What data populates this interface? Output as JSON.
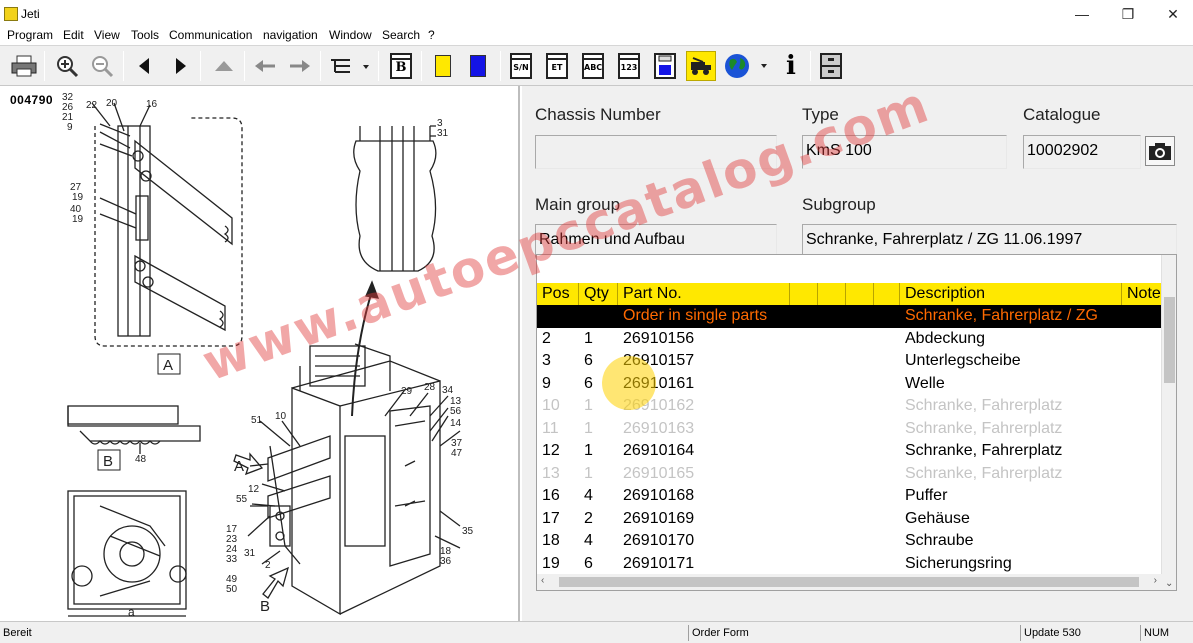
{
  "window": {
    "title": "Jeti"
  },
  "menu": [
    "Program",
    "Edit",
    "View",
    "Tools",
    "Communication",
    "navigation",
    "Window",
    "Search",
    "?"
  ],
  "toolbar": {
    "icons": [
      "printer-icon",
      "zoom-in-icon",
      "zoom-out-icon",
      "back-triangle-icon",
      "forward-triangle-icon",
      "up-triangle-icon",
      "arrow-left-icon",
      "arrow-right-icon",
      "tree-view-icon",
      "bookmark-b-icon",
      "yellow-square-icon",
      "blue-square-icon",
      "doc-sn-icon",
      "doc-et-icon",
      "doc-abc-icon",
      "doc-123-icon",
      "save-disk-icon",
      "truck-icon",
      "globe-icon",
      "info-icon",
      "cabinet-icon"
    ],
    "doc_labels": {
      "sn": "S/N",
      "et": "ET",
      "abc": "ABC",
      "num": "123"
    },
    "bookmark_letter": "B",
    "info_glyph": "i"
  },
  "drawing": {
    "id": "004790",
    "callouts": [
      "32",
      "26",
      "21",
      "9",
      "22",
      "20",
      "16",
      "27",
      "19",
      "40",
      "19",
      "3",
      "31",
      "29",
      "28",
      "34",
      "13",
      "56",
      "14",
      "37",
      "47",
      "51",
      "10",
      "12",
      "55",
      "17",
      "23",
      "24",
      "33",
      "49",
      "50",
      "31",
      "2",
      "48",
      "35",
      "18",
      "36"
    ],
    "view_labels": [
      "A",
      "B",
      "A",
      "B"
    ],
    "dim_label": "a"
  },
  "fields": {
    "chassis_label": "Chassis Number",
    "chassis_value": "",
    "type_label": "Type",
    "type_value": "KmS 100",
    "catalogue_label": "Catalogue",
    "catalogue_value": "10002902",
    "main_group_label": "Main group",
    "main_group_value": "Rahmen und Aufbau",
    "subgroup_label": "Subgroup",
    "subgroup_value": "Schranke, Fahrerplatz / ZG 11.06.1997"
  },
  "grid": {
    "columns": {
      "pos": "Pos",
      "qty": "Qty",
      "part": "Part No.",
      "desc": "Description",
      "note": "Note"
    },
    "rows": [
      {
        "pos": "",
        "qty": "",
        "part": "Order in single parts",
        "desc": "Schranke, Fahrerplatz / ZG",
        "state": "selected"
      },
      {
        "pos": "2",
        "qty": "1",
        "part": "26910156",
        "desc": "Abdeckung",
        "state": "normal"
      },
      {
        "pos": "3",
        "qty": "6",
        "part": "26910157",
        "desc": "Unterlegscheibe",
        "state": "normal"
      },
      {
        "pos": "9",
        "qty": "6",
        "part": "26910161",
        "desc": "Welle",
        "state": "normal"
      },
      {
        "pos": "10",
        "qty": "1",
        "part": "26910162",
        "desc": "Schranke, Fahrerplatz",
        "state": "disabled"
      },
      {
        "pos": "11",
        "qty": "1",
        "part": "26910163",
        "desc": "Schranke, Fahrerplatz",
        "state": "disabled"
      },
      {
        "pos": "12",
        "qty": "1",
        "part": "26910164",
        "desc": "Schranke, Fahrerplatz",
        "state": "normal"
      },
      {
        "pos": "13",
        "qty": "1",
        "part": "26910165",
        "desc": "Schranke, Fahrerplatz",
        "state": "disabled"
      },
      {
        "pos": "16",
        "qty": "4",
        "part": "26910168",
        "desc": "Puffer",
        "state": "normal"
      },
      {
        "pos": "17",
        "qty": "2",
        "part": "26910169",
        "desc": "Gehäuse",
        "state": "normal"
      },
      {
        "pos": "18",
        "qty": "4",
        "part": "26910170",
        "desc": "Schraube",
        "state": "normal"
      },
      {
        "pos": "19",
        "qty": "6",
        "part": "26910171",
        "desc": "Sicherungsring",
        "state": "normal"
      }
    ]
  },
  "watermark": "www.autoepccatalog.com",
  "status": {
    "left": "Bereit",
    "mid": "Order Form",
    "update": "Update 530",
    "num": "NUM"
  },
  "colors": {
    "header_yellow": "#ffe800",
    "selected_text": "#ff6a00",
    "disabled_text": "#c4c4c4"
  }
}
